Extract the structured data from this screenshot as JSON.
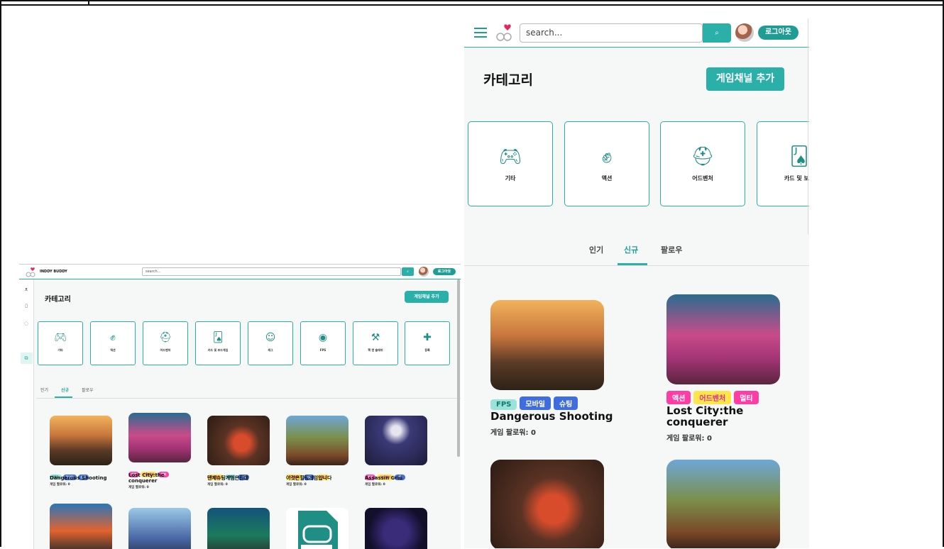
{
  "small": {
    "brand": "INDDY BUDDY",
    "search_placeholder": "search...",
    "logout": "로그아웃",
    "title": "카테고리",
    "add_channel": "게임채널 추가",
    "categories": [
      "기타",
      "액션",
      "어드벤처",
      "카드 및 보드게임",
      "캐그",
      "FPS",
      "핵 앤 슬래쉬",
      "등록"
    ],
    "tabs": [
      "인기",
      "신규",
      "팔로우"
    ],
    "active_tab": "신규",
    "cards": [
      {
        "name": "Dangerous Shooting",
        "tags": [
          "FPS",
          "모바일",
          "슈팅"
        ],
        "follow": "게임 팔로워: 0"
      },
      {
        "name": "Lost City:the conquerer",
        "tags": [
          "액션",
          "어드벤처",
          "멀티"
        ],
        "follow": "게임 팔로워: 0"
      },
      {
        "name": "텐제슈팅게임은뭔데",
        "tags": [
          "어드벤처",
          "FPS",
          "슈팅"
        ],
        "follow": "게임 팔로워: 0"
      },
      {
        "name": "이것은힐링게임입니다",
        "tags": [
          "어드벤처",
          "퍼즐",
          "스토리"
        ],
        "follow": "게임 팔로워: 0"
      },
      {
        "name": "Assassin Grid",
        "tags": [
          "액션",
          "어드벤처",
          "전략"
        ],
        "follow": "게임 팔로워: 0"
      }
    ]
  },
  "large": {
    "search_placeholder": "search...",
    "logout": "로그아웃",
    "title": "카테고리",
    "add_channel": "게임채널 추가",
    "categories": [
      "기타",
      "액션",
      "어드벤처",
      "카드 및 보드"
    ],
    "tabs": [
      "인기",
      "신규",
      "팔로우"
    ],
    "active_tab": "신규",
    "cards": [
      {
        "name": "Dangerous Shooting",
        "tags": [
          "FPS",
          "모바일",
          "슈팅"
        ],
        "follow": "게임 팔로워: 0"
      },
      {
        "name": "Lost City:the conquerer",
        "tags": [
          "액션",
          "어드벤처",
          "멀티"
        ],
        "follow": "게임 팔로워: 0"
      }
    ]
  },
  "colors": {
    "accent": "#2ab0a8",
    "tag_pink": "#ff3ea5",
    "tag_blue": "#3f6de0",
    "tag_yellow": "#ffe44a",
    "tag_mint": "#9be2d8"
  }
}
